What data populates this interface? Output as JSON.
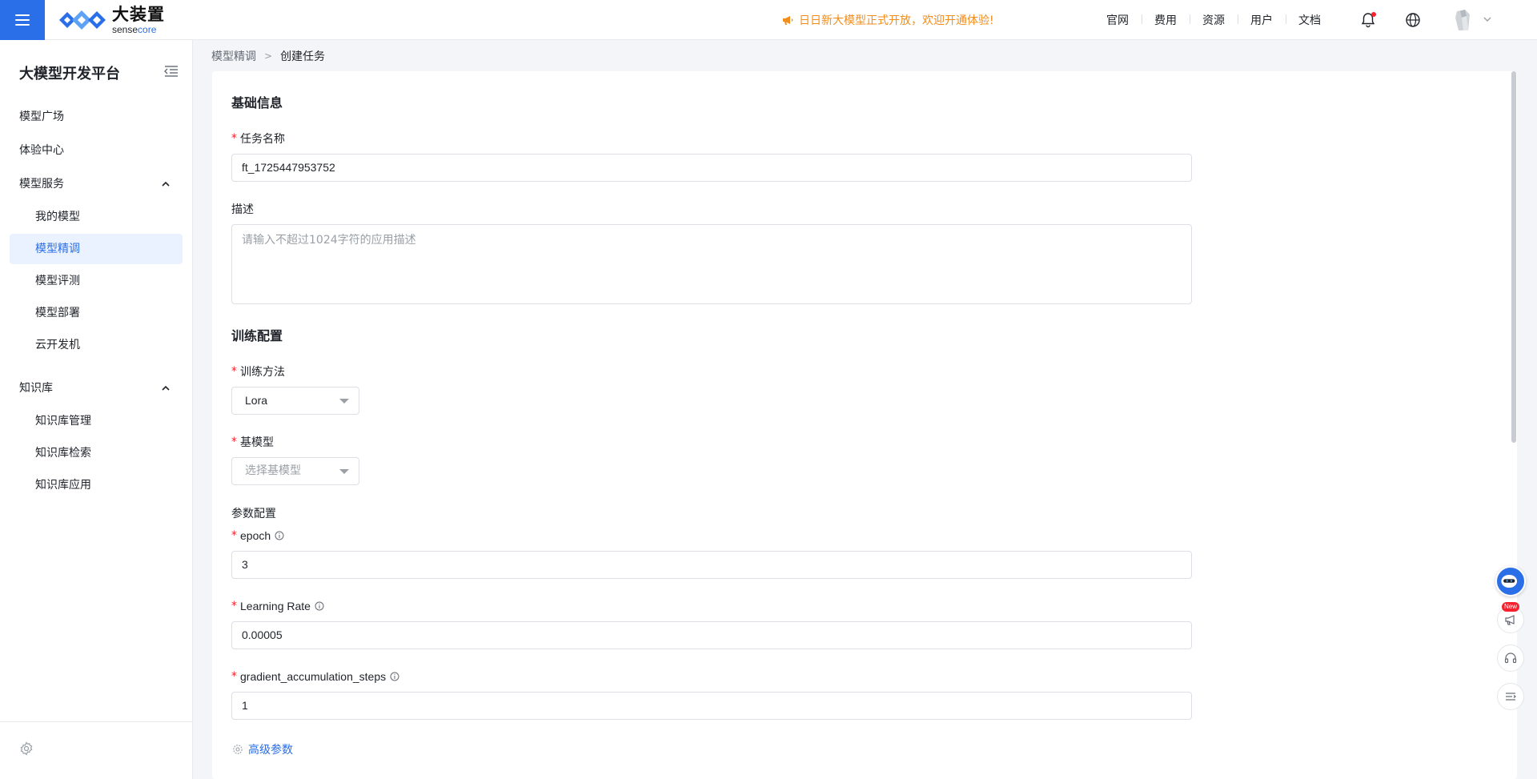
{
  "header": {
    "logo_cn": "大装置",
    "logo_en_a": "sense",
    "logo_en_b": "core",
    "notice": "日日新大模型正式开放，欢迎开通体验!",
    "nav": [
      "官网",
      "费用",
      "资源",
      "用户",
      "文档"
    ]
  },
  "sidebar": {
    "title": "大模型开发平台",
    "items": [
      {
        "label": "模型广场"
      },
      {
        "label": "体验中心"
      },
      {
        "label": "模型服务"
      },
      {
        "label": "我的模型"
      },
      {
        "label": "模型精调"
      },
      {
        "label": "模型评测"
      },
      {
        "label": "模型部署"
      },
      {
        "label": "云开发机"
      },
      {
        "label": "知识库"
      },
      {
        "label": "知识库管理"
      },
      {
        "label": "知识库检索"
      },
      {
        "label": "知识库应用"
      }
    ],
    "active_item": "模型精调"
  },
  "breadcrumb": {
    "parent": "模型精调",
    "separator": ">",
    "current": "创建任务"
  },
  "form": {
    "basic_title": "基础信息",
    "task_name_label": "任务名称",
    "task_name_value": "ft_1725447953752",
    "desc_label": "描述",
    "desc_placeholder": "请输入不超过1024字符的应用描述",
    "train_title": "训练配置",
    "method_label": "训练方法",
    "method_value": "Lora",
    "base_model_label": "基模型",
    "base_model_placeholder": "选择基模型",
    "params_title": "参数配置",
    "epoch_label": "epoch",
    "epoch_value": "3",
    "lr_label": "Learning Rate",
    "lr_value": "0.00005",
    "gas_label": "gradient_accumulation_steps",
    "gas_value": "1",
    "required_mark": "*",
    "advanced_link": "高级参数"
  },
  "float_tools": {
    "new_badge": "New"
  },
  "colors": {
    "accent": "#2a6ee8",
    "notice": "#f28c1a",
    "required": "#f5222d",
    "active_bg": "#e9f2fe"
  }
}
